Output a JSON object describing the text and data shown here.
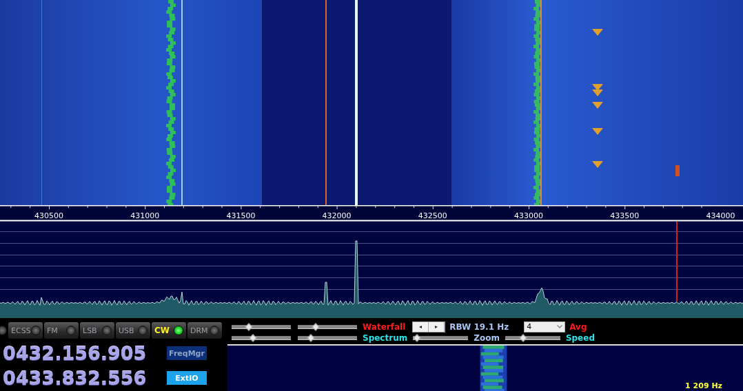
{
  "frequency_axis": [
    "430500",
    "431000",
    "431500",
    "432000",
    "432500",
    "433000",
    "433500",
    "434000"
  ],
  "modes": [
    {
      "label": "ECSS",
      "selected": false
    },
    {
      "label": "FM",
      "selected": false
    },
    {
      "label": "LSB",
      "selected": false
    },
    {
      "label": "USB",
      "selected": false
    },
    {
      "label": "CW",
      "selected": true
    },
    {
      "label": "DRM",
      "selected": false
    }
  ],
  "frequencies": [
    {
      "value": "0432.156.905",
      "button": {
        "label": "FreqMgr",
        "active": false
      }
    },
    {
      "value": "0433.832.556",
      "button": {
        "label": "ExtIO",
        "active": true
      }
    }
  ],
  "controls": {
    "waterfall_sliders": [
      {
        "level": 0.25
      },
      {
        "level": 0.27
      }
    ],
    "spectrum_sliders": [
      {
        "level": 0.34
      },
      {
        "level": 0.17
      }
    ],
    "waterfall_label": "Waterfall",
    "spectrum_label": "Spectrum",
    "spin_left": "◂",
    "spin_right": "▸",
    "rbw": "RBW 19.1 Hz",
    "avg_value": "4",
    "avg_label": "Avg",
    "zoom_slider": {
      "level": 0.0
    },
    "zoom_label": "Zoom",
    "speed_slider": {
      "level": 0.3
    },
    "speed_label": "Speed"
  },
  "audio_waterfall": {
    "readout": "1 209 Hz"
  }
}
